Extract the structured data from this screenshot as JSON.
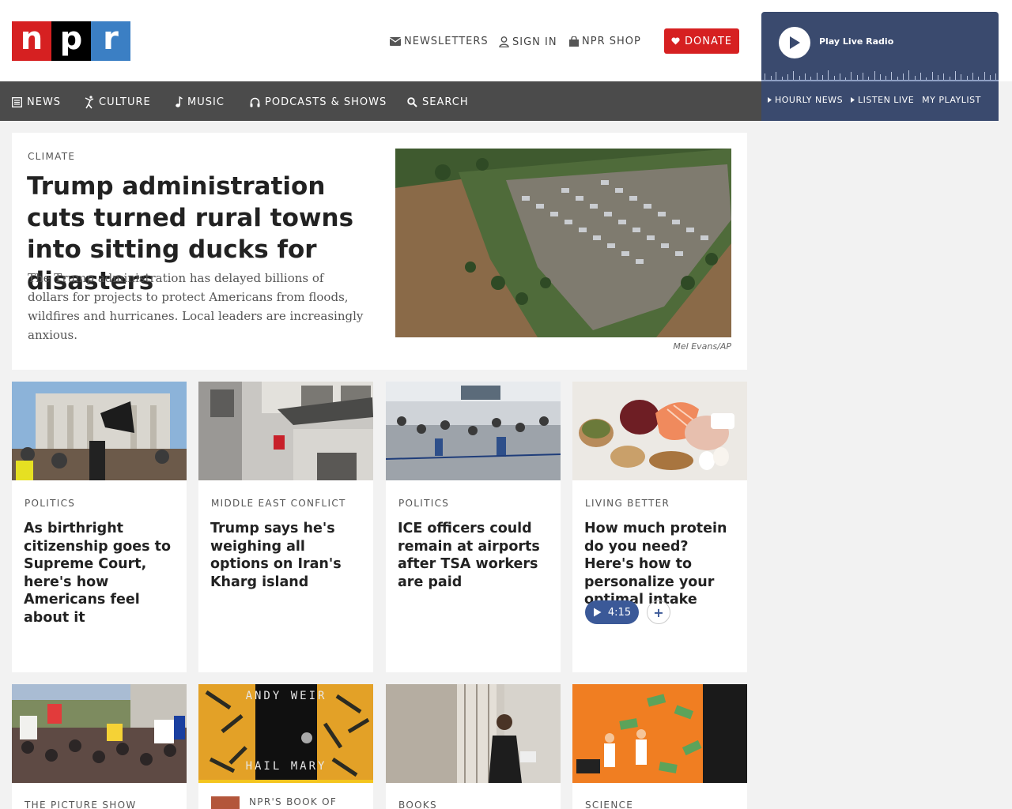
{
  "brand": {
    "letters": [
      "n",
      "p",
      "r"
    ],
    "colors": [
      "#d62021",
      "#000000",
      "#3b7fc4"
    ]
  },
  "utility": {
    "newsletters": "NEWSLETTERS",
    "sign_in": "SIGN IN",
    "shop": "NPR SHOP",
    "donate": "DONATE"
  },
  "player": {
    "play_label": "Play Live Radio",
    "links": [
      "HOURLY NEWS",
      "LISTEN LIVE",
      "MY PLAYLIST"
    ]
  },
  "nav": {
    "news": "NEWS",
    "culture": "CULTURE",
    "music": "MUSIC",
    "podcasts": "PODCASTS & SHOWS",
    "search": "SEARCH"
  },
  "hero": {
    "eyebrow": "CLIMATE",
    "title": "Trump administration cuts turned rural towns into sitting ducks for disasters",
    "teaser": "The Trump administration has delayed billions of dollars for projects to protect Americans from floods, wildfires and hurricanes. Local leaders are increasingly anxious.",
    "credit": "Mel Evans/AP"
  },
  "cards": [
    {
      "eyebrow": "POLITICS",
      "title": "As birthright citizenship goes to Supreme Court, here's how Americans feel about it"
    },
    {
      "eyebrow": "MIDDLE EAST CONFLICT",
      "title": "Trump says he's weighing all options on Iran's Kharg island"
    },
    {
      "eyebrow": "POLITICS",
      "title": "ICE officers could remain at airports after TSA workers are paid"
    },
    {
      "eyebrow": "LIVING BETTER",
      "title": "How much protein do you need? Here's how to personalize your optimal intake",
      "audio_duration": "4:15"
    },
    {
      "eyebrow": "THE PICTURE SHOW"
    },
    {
      "eyebrow": "NPR'S BOOK OF"
    },
    {
      "eyebrow": "BOOKS"
    },
    {
      "eyebrow": "SCIENCE"
    }
  ],
  "book_cover": {
    "author": "ANDY WEIR",
    "title": "HAIL MARY"
  },
  "accent_colors": {
    "donate": "#d62021",
    "player": "#3a4a6e",
    "nav": "#4b4b4b",
    "audio": "#3b5998"
  }
}
